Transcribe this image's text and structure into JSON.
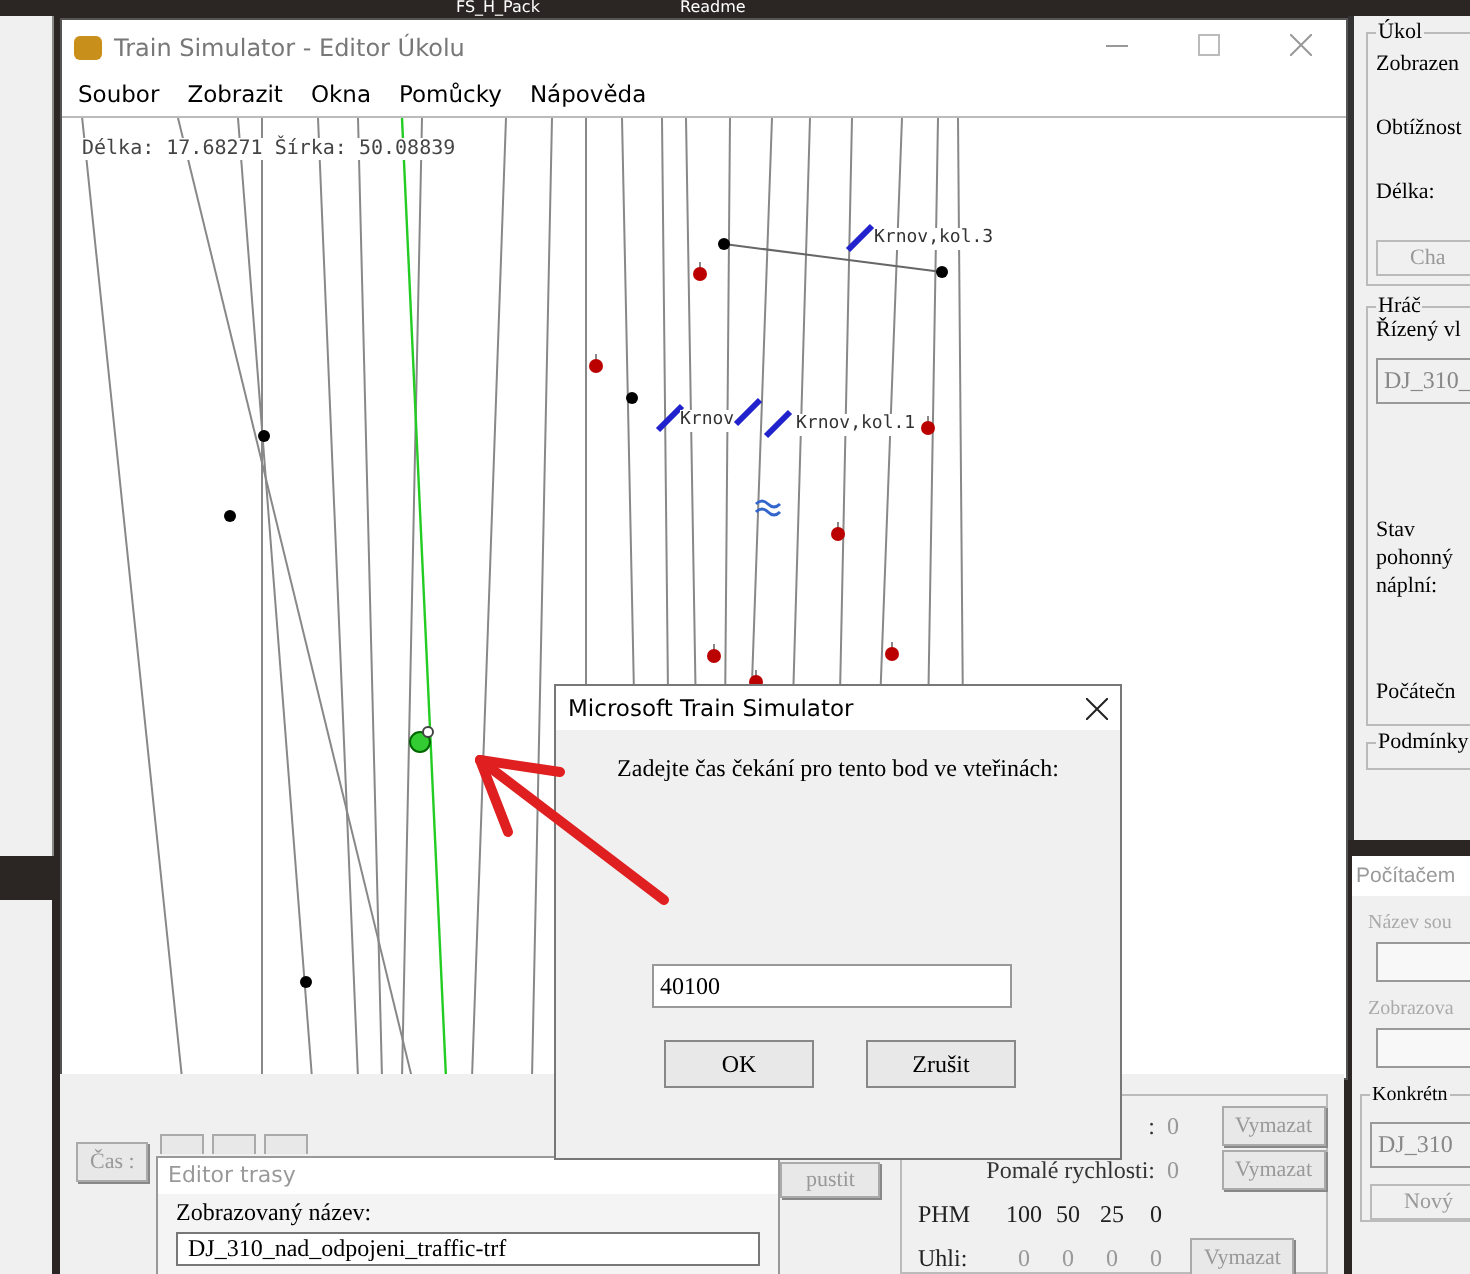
{
  "desktop": {
    "icon_labels": [
      "FS_H_Pack",
      "Readme"
    ]
  },
  "main_window": {
    "title": "Train Simulator - Editor Úkolu",
    "menu": [
      "Soubor",
      "Zobrazit",
      "Okna",
      "Pomůcky",
      "Nápověda"
    ],
    "map": {
      "coordinates": "Délka: 17.68271 Šírka: 50.08839",
      "markers": [
        {
          "label": "Krnov,kol.3"
        },
        {
          "label": "Krnov"
        },
        {
          "label": "Krnov,kol.1"
        }
      ]
    }
  },
  "task_panel": {
    "group": "Úkol",
    "labels": [
      "Zobrazen",
      "Obtížnost",
      "Délka:"
    ],
    "button": "Cha"
  },
  "player_panel": {
    "group": "Hráč",
    "label": "Řízený vl",
    "value": "DJ_310_",
    "disabled": true,
    "fuel_label": "Stav pohonný náplní:",
    "start_label": "Počátečn",
    "next_group": "Podmínky"
  },
  "computer_window": {
    "title": "Počítačem",
    "labels": [
      "Název sou",
      "Zobrazova"
    ],
    "group": "Konkrétn",
    "value": "DJ_310",
    "disabled": true,
    "button": "Nový"
  },
  "bottom_panel": {
    "time_button": "Čas :",
    "start_button": "pustit",
    "rows": [
      {
        "label": ":",
        "value": "0",
        "button": "Vymazat"
      },
      {
        "label": "Pomalé rychlosti:",
        "value": "0",
        "button": "Vymazat"
      }
    ],
    "fuel_header": {
      "label": "PHM",
      "levels": [
        "100",
        "50",
        "25",
        "0"
      ]
    },
    "coal_row": {
      "label": "Uhli:",
      "values": [
        "0",
        "0",
        "0",
        "0"
      ],
      "button": "Vymazat"
    }
  },
  "route_editor": {
    "title": "Editor trasy",
    "label": "Zobrazovaný název:",
    "value": "DJ_310_nad_odpojeni_traffic-trf"
  },
  "dialog": {
    "title": "Microsoft Train Simulator",
    "message": "Zadejte čas čekání pro tento bod ve vteřinách:",
    "input_value": "40100",
    "buttons": [
      "OK",
      "Zrušit"
    ]
  }
}
